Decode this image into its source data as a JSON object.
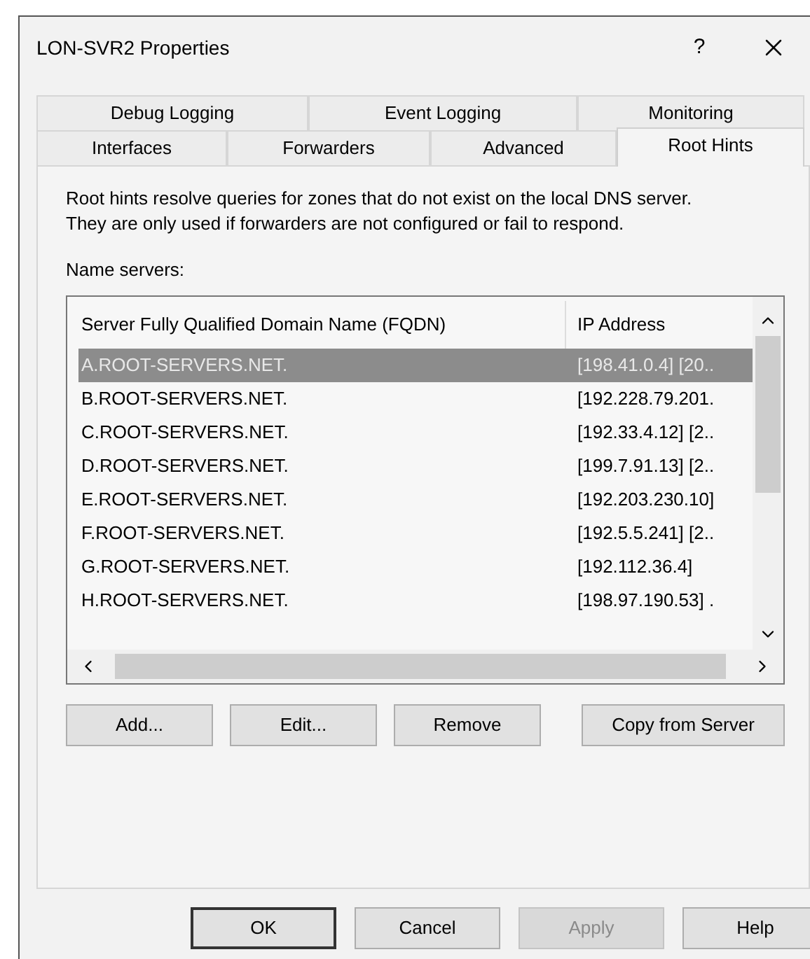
{
  "window": {
    "title": "LON-SVR2 Properties",
    "help": "?"
  },
  "tab_rows": [
    [
      {
        "label": "Debug Logging",
        "selected": false
      },
      {
        "label": "Event Logging",
        "selected": false
      },
      {
        "label": "Monitoring",
        "selected": false
      }
    ],
    [
      {
        "label": "Interfaces",
        "selected": false
      },
      {
        "label": "Forwarders",
        "selected": false
      },
      {
        "label": "Advanced",
        "selected": false
      },
      {
        "label": "Root Hints",
        "selected": true
      }
    ]
  ],
  "description": "Root hints resolve queries for zones that do not exist on the local DNS server.   They are only used if forwarders are not configured or fail to respond.",
  "list_label": "Name servers:",
  "table": {
    "columns": [
      "Server Fully Qualified Domain Name (FQDN)",
      "IP Address"
    ],
    "rows": [
      {
        "fqdn": "A.ROOT-SERVERS.NET.",
        "ip": "[198.41.0.4] [20..",
        "selected": true
      },
      {
        "fqdn": "B.ROOT-SERVERS.NET.",
        "ip": "[192.228.79.201.",
        "selected": false
      },
      {
        "fqdn": "C.ROOT-SERVERS.NET.",
        "ip": "[192.33.4.12] [2..",
        "selected": false
      },
      {
        "fqdn": "D.ROOT-SERVERS.NET.",
        "ip": "[199.7.91.13] [2..",
        "selected": false
      },
      {
        "fqdn": "E.ROOT-SERVERS.NET.",
        "ip": "[192.203.230.10]",
        "selected": false
      },
      {
        "fqdn": "F.ROOT-SERVERS.NET.",
        "ip": "[192.5.5.241] [2..",
        "selected": false
      },
      {
        "fqdn": "G.ROOT-SERVERS.NET.",
        "ip": "[192.112.36.4]",
        "selected": false
      },
      {
        "fqdn": "H.ROOT-SERVERS.NET.",
        "ip": "[198.97.190.53] .",
        "selected": false
      }
    ]
  },
  "list_buttons": [
    "Add...",
    "Edit...",
    "Remove",
    "Copy from Server"
  ],
  "dialog_buttons": [
    {
      "label": "OK",
      "default": true,
      "disabled": false
    },
    {
      "label": "Cancel",
      "default": false,
      "disabled": false
    },
    {
      "label": "Apply",
      "default": false,
      "disabled": true
    },
    {
      "label": "Help",
      "default": false,
      "disabled": false
    }
  ]
}
